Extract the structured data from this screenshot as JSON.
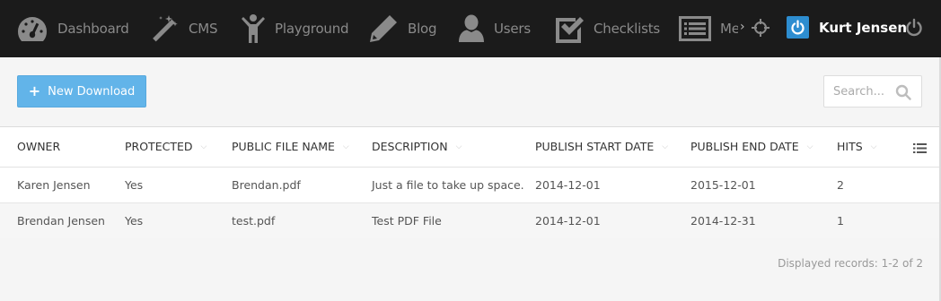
{
  "nav": {
    "items": [
      {
        "label": "Dashboard",
        "icon": "dashboard-icon"
      },
      {
        "label": "CMS",
        "icon": "magic-wand-icon"
      },
      {
        "label": "Playground",
        "icon": "child-icon"
      },
      {
        "label": "Blog",
        "icon": "pencil-icon"
      },
      {
        "label": "Users",
        "icon": "user-icon"
      },
      {
        "label": "Checklists",
        "icon": "checkbox-icon"
      },
      {
        "label": "Me",
        "icon": "list-icon"
      }
    ],
    "more_arrow": "›",
    "user_name": "Kurt Jensen"
  },
  "toolbar": {
    "new_button_label": "New Download",
    "search_placeholder": "Search..."
  },
  "table": {
    "columns": [
      "OWNER",
      "PROTECTED",
      "PUBLIC FILE NAME",
      "DESCRIPTION",
      "PUBLISH START DATE",
      "PUBLISH END DATE",
      "HITS"
    ],
    "rows": [
      [
        "Karen Jensen",
        "Yes",
        "Brendan.pdf",
        "Just a file to take up space.",
        "2014-12-01",
        "2015-12-01",
        "2"
      ],
      [
        "Brendan Jensen",
        "Yes",
        "test.pdf",
        "Test PDF File",
        "2014-12-01",
        "2014-12-31",
        "1"
      ]
    ]
  },
  "footer": {
    "records_text": "Displayed records: 1-2 of 2"
  },
  "colors": {
    "nav_bg": "#1b1b1b",
    "nav_text": "#8a8a8a",
    "primary_button": "#62b4e9",
    "user_badge": "#2d8dd0"
  }
}
